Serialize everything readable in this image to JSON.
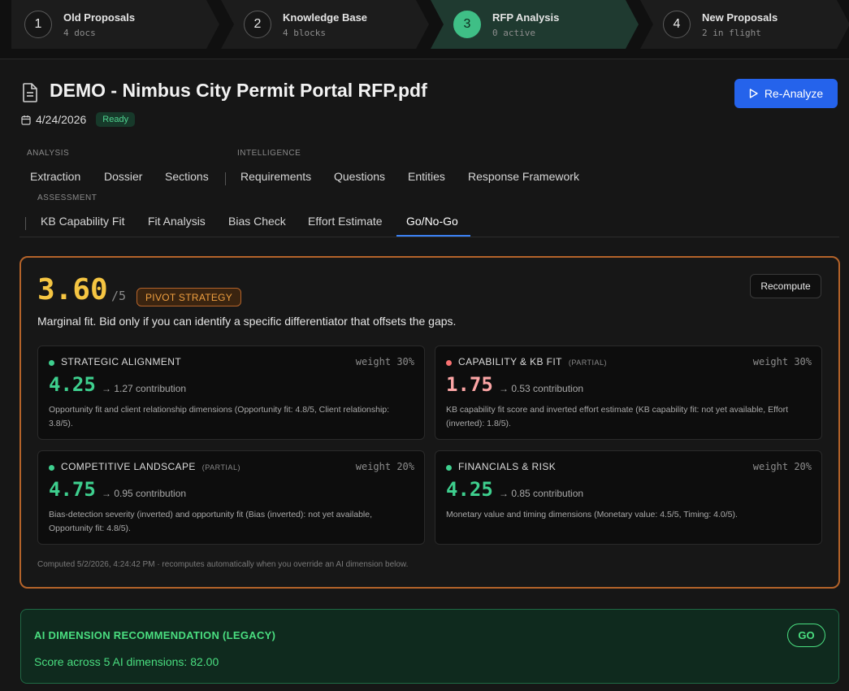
{
  "stepper": [
    {
      "num": "1",
      "title": "Old Proposals",
      "sub": "4 docs"
    },
    {
      "num": "2",
      "title": "Knowledge Base",
      "sub": "4 blocks"
    },
    {
      "num": "3",
      "title": "RFP Analysis",
      "sub": "0 active"
    },
    {
      "num": "4",
      "title": "New Proposals",
      "sub": "2 in flight"
    }
  ],
  "document": {
    "title": "DEMO - Nimbus City Permit Portal RFP.pdf",
    "date": "4/24/2026",
    "status": "Ready",
    "action_label": "Re-Analyze"
  },
  "tabs": {
    "analysis_label": "ANALYSIS",
    "intelligence_label": "INTELLIGENCE",
    "assessment_label": "ASSESSMENT",
    "analysis": [
      "Extraction",
      "Dossier",
      "Sections"
    ],
    "intelligence": [
      "Requirements",
      "Questions",
      "Entities",
      "Response Framework"
    ],
    "assessment": [
      "KB Capability Fit",
      "Fit Analysis",
      "Bias Check",
      "Effort Estimate",
      "Go/No-Go"
    ],
    "active": "Go/No-Go"
  },
  "score": {
    "value": "3.60",
    "max": "/5",
    "verdict_badge": "PIVOT STRATEGY",
    "recompute_label": "Recompute",
    "summary": "Marginal fit. Bid only if you can identify a specific differentiator that offsets the gaps.",
    "computed_note": "Computed 5/2/2026, 4:24:42 PM · recomputes automatically when you override an AI dimension below."
  },
  "dimensions": [
    {
      "name": "STRATEGIC ALIGNMENT",
      "partial": "",
      "weight": "weight 30%",
      "score": "4.25",
      "contribution": "→ 1.27 contribution",
      "description": "Opportunity fit and client relationship dimensions (Opportunity fit: 4.8/5, Client relationship: 3.8/5).",
      "color": "#3ecf8e"
    },
    {
      "name": "CAPABILITY & KB FIT",
      "partial": "(PARTIAL)",
      "weight": "weight 30%",
      "score": "1.75",
      "contribution": "→ 0.53 contribution",
      "description": "KB capability fit score and inverted effort estimate (KB capability fit: not yet available, Effort (inverted): 1.8/5).",
      "color": "#f87171"
    },
    {
      "name": "COMPETITIVE LANDSCAPE",
      "partial": "(PARTIAL)",
      "weight": "weight 20%",
      "score": "4.75",
      "contribution": "→ 0.95 contribution",
      "description": "Bias-detection severity (inverted) and opportunity fit (Bias (inverted): not yet available, Opportunity fit: 4.8/5).",
      "color": "#3ecf8e"
    },
    {
      "name": "FINANCIALS & RISK",
      "partial": "",
      "weight": "weight 20%",
      "score": "4.25",
      "contribution": "→ 0.85 contribution",
      "description": "Monetary value and timing dimensions (Monetary value: 4.5/5, Timing: 4.0/5).",
      "color": "#3ecf8e"
    }
  ],
  "legacy": {
    "title": "AI DIMENSION RECOMMENDATION (LEGACY)",
    "subtitle": "Score across 5 AI dimensions: 82.00",
    "badge": "GO"
  },
  "colors": {
    "accent_blue": "#2563eb",
    "score_yellow": "#f5c542",
    "pivot_orange": "#f0a040",
    "go_green": "#4ade80",
    "stepper_active": "#1f3a30"
  }
}
